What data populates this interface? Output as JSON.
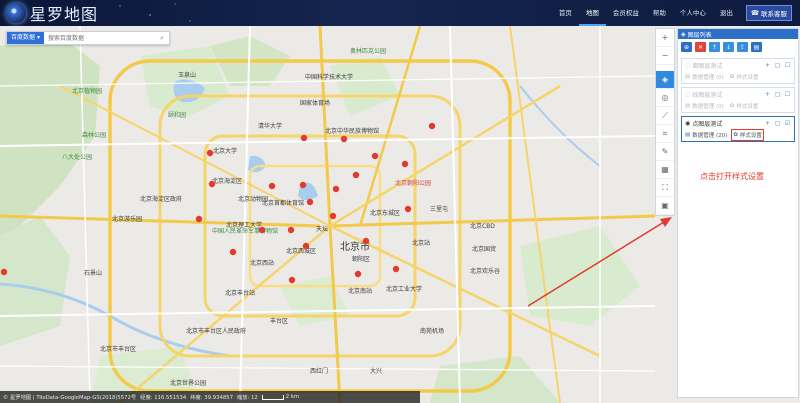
{
  "app": {
    "title": "星罗地图"
  },
  "nav": {
    "items": [
      "首页",
      "地图",
      "会员权益",
      "帮助",
      "个人中心",
      "退出"
    ],
    "active": "地图",
    "contact": "联系客服"
  },
  "search": {
    "source_label": "百度数据",
    "placeholder": "搜索百度数据"
  },
  "panel": {
    "title": "图层列表",
    "tool_colors": [
      "#2d6fc7",
      "#e0453a",
      "#3a8ee0",
      "#3a8ee0",
      "#3a8ee0",
      "#2d6fc7"
    ],
    "layers": [
      {
        "name": "面图层测试",
        "data_label": "数据管理 (0)",
        "style_label": "样式设置"
      },
      {
        "name": "线图层测试",
        "data_label": "数据管理 (0)",
        "style_label": "样式设置"
      },
      {
        "name": "点图层测试",
        "data_label": "数据管理 (20)",
        "style_label": "样式设置"
      }
    ]
  },
  "annotation": "点击打开样式设置",
  "status": {
    "source": "© 星罗地图 | TileData-GoogleMap-GS(2018)5572号",
    "lng": "经度: 116.551534",
    "lat": "纬度: 39.934857",
    "zoom": "缩放: 12",
    "scale": "2 km"
  },
  "map": {
    "city_label": "北京市",
    "labels": [
      "北京植物园",
      "森林公园",
      "八大处公园",
      "玉泉山",
      "颐和园",
      "中国科学技术大学",
      "奥林匹克公园",
      "北京中华民族博物馆",
      "国家体育场",
      "北京大学",
      "清华大学",
      "北京理工大学",
      "北京海淀区",
      "北京朝阳公园",
      "北京动物园",
      "北京西站",
      "天坛",
      "北京南站",
      "北京游乐园",
      "北京工业大学",
      "朝阳区",
      "北京丰台站",
      "石景山",
      "北京世界公园",
      "北京市丰台区",
      "西红门",
      "大兴",
      "丰台区",
      "中国人民革命军事博物馆",
      "北京站",
      "三里屯",
      "北京欢乐谷",
      "北京市丰台区人民政府",
      "南苑机场",
      "北京CBD",
      "北京国贸",
      "北京首都体育馆",
      "北京海淀区政府",
      "北京西城区",
      "北京东城区"
    ],
    "marker_color": "#e23a2e"
  }
}
